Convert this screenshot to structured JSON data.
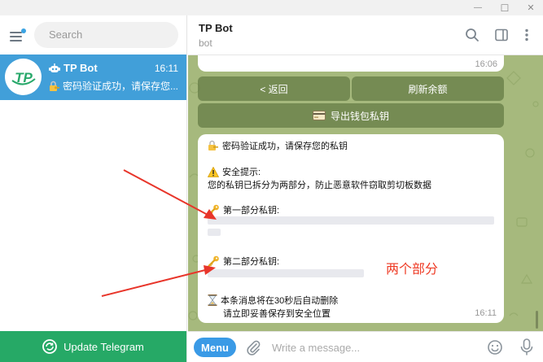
{
  "window": {
    "minimize_glyph": "—",
    "maximize_glyph": "☐",
    "close_glyph": "✕"
  },
  "sidebar": {
    "search_placeholder": "Search",
    "chats": [
      {
        "title": "TP Bot",
        "time": "16:11",
        "preview": "密码验证成功，请保存您...",
        "avatar_text": "TP",
        "preview_icon": "lock-with-key-icon",
        "title_icon": "bot-icon"
      }
    ],
    "update_label": "Update Telegram"
  },
  "header": {
    "name": "TP Bot",
    "status": "bot"
  },
  "messages": {
    "prev_time": "16:06",
    "keyboard": {
      "back": "< 返回",
      "refresh": "刷新余额",
      "export": "导出钱包私钥"
    },
    "main": {
      "verify_line": "密码验证成功，请保存您的私钥",
      "security_title": "安全提示:",
      "security_body": "您的私钥已拆分为两部分，防止恶意软件窃取剪切板数据",
      "part1_label": "第一部分私钥:",
      "part2_label": "第二部分私钥:",
      "auto_delete": "本条消息将在30秒后自动删除",
      "save_hint": "请立即妥善保存到安全位置",
      "time": "16:11"
    }
  },
  "annotation": {
    "text": "两个部分",
    "color": "#ee3a24"
  },
  "composer": {
    "menu_label": "Menu",
    "placeholder": "Write a message..."
  },
  "colors": {
    "accent": "#419fd9",
    "update_green": "#26a966",
    "chat_bg": "#a6b97d",
    "menu_blue": "#3a9ae6"
  }
}
